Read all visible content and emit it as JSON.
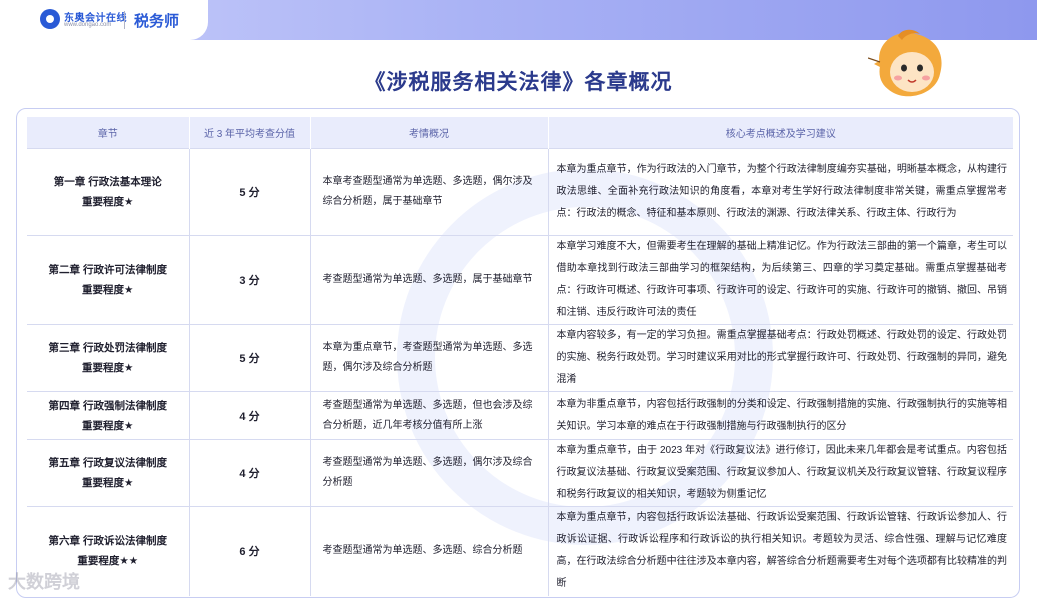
{
  "header": {
    "logo_name": "东奥会计在线",
    "logo_url": "www.dongao.com",
    "subject": "税务师"
  },
  "title": "《涉税服务相关法律》各章概况",
  "table": {
    "headers": [
      "章节",
      "近 3 年平均考查分值",
      "考情概况",
      "核心考点概述及学习建议"
    ],
    "rows": [
      {
        "chapter": "第一章  行政法基本理论",
        "importance": "重要程度★",
        "score": "5 分",
        "overview": "本章考查题型通常为单选题、多选题，偶尔涉及综合分析题，属于基础章节",
        "advice": "本章为重点章节，作为行政法的入门章节，为整个行政法律制度编夯实基础，明晰基本概念，从构建行政法思维、全面补充行政法知识的角度看，本章对考生学好行政法律制度非常关键，需重点掌握常考点：行政法的概念、特征和基本原则、行政法的渊源、行政法律关系、行政主体、行政行为"
      },
      {
        "chapter": "第二章  行政许可法律制度",
        "importance": "重要程度★",
        "score": "3 分",
        "overview": "考查题型通常为单选题、多选题，属于基础章节",
        "advice": "本章学习难度不大，但需要考生在理解的基础上精准记忆。作为行政法三部曲的第一个篇章，考生可以借助本章找到行政法三部曲学习的框架结构，为后续第三、四章的学习奠定基础。需重点掌握基础考点：行政许可概述、行政许可事项、行政许可的设定、行政许可的实施、行政许可的撤销、撤回、吊销和注销、违反行政许可法的责任"
      },
      {
        "chapter": "第三章  行政处罚法律制度",
        "importance": "重要程度★",
        "score": "5 分",
        "overview": "本章为重点章节，考查题型通常为单选题、多选题，偶尔涉及综合分析题",
        "advice": "本章内容较多，有一定的学习负担。需重点掌握基础考点：行政处罚概述、行政处罚的设定、行政处罚的实施、税务行政处罚。学习时建议采用对比的形式掌握行政许可、行政处罚、行政强制的异同，避免混淆"
      },
      {
        "chapter": "第四章  行政强制法律制度",
        "importance": "重要程度★",
        "score": "4 分",
        "overview": "考查题型通常为单选题、多选题，但也会涉及综合分析题，近几年考核分值有所上涨",
        "advice": "本章为非重点章节，内容包括行政强制的分类和设定、行政强制措施的实施、行政强制执行的实施等相关知识。学习本章的难点在于行政强制措施与行政强制执行的区分"
      },
      {
        "chapter": "第五章  行政复议法律制度",
        "importance": "重要程度★",
        "score": "4 分",
        "overview": "考查题型通常为单选题、多选题，偶尔涉及综合分析题",
        "advice": "本章为重点章节，由于 2023 年对《行政复议法》进行修订，因此未来几年都会是考试重点。内容包括行政复议法基础、行政复议受案范围、行政复议参加人、行政复议机关及行政复议管辖、行政复议程序和税务行政复议的相关知识，考题较为侧重记忆"
      },
      {
        "chapter": "第六章  行政诉讼法律制度",
        "importance": "重要程度★★",
        "score": "6 分",
        "overview": "考查题型通常为单选题、多选题、综合分析题",
        "advice": "本章为重点章节，内容包括行政诉讼法基础、行政诉讼受案范围、行政诉讼管辖、行政诉讼参加人、行政诉讼证据、行政诉讼程序和行政诉讼的执行相关知识。考题较为灵活、综合性强、理解与记忆难度高，在行政法综合分析题中往往涉及本章内容，解答综合分析题需要考生对每个选项都有比较精准的判断"
      }
    ]
  },
  "watermark": "大数跨境",
  "colors": {
    "accent": "#2b3a8c",
    "header_band": "#aab3f5",
    "table_head": "#e9ecfc"
  }
}
